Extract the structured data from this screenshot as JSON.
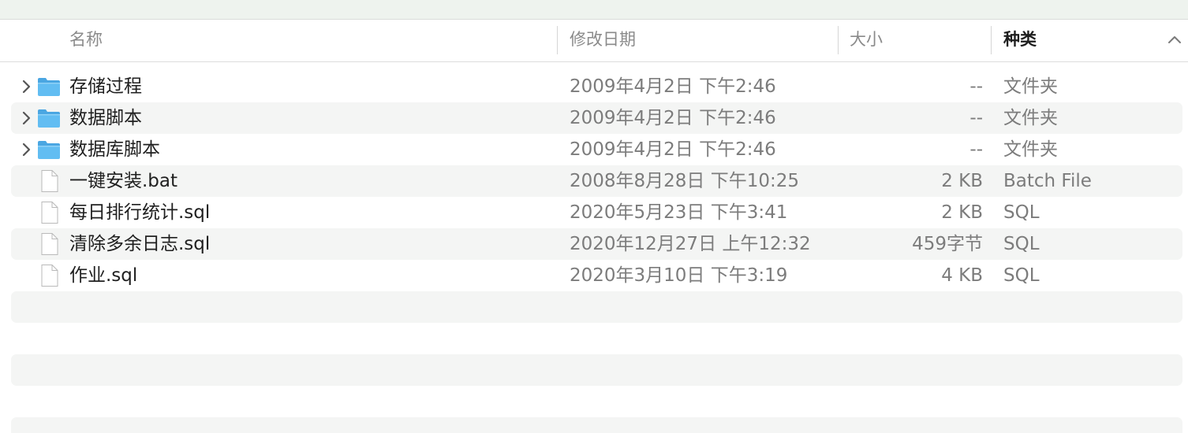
{
  "columns": {
    "name": "名称",
    "date": "修改日期",
    "size": "大小",
    "kind": "种类"
  },
  "rows": [
    {
      "name": "存储过程",
      "date": "2009年4月2日 下午2:46",
      "size": "--",
      "kind": "文件夹",
      "type": "folder"
    },
    {
      "name": "数据脚本",
      "date": "2009年4月2日 下午2:46",
      "size": "--",
      "kind": "文件夹",
      "type": "folder"
    },
    {
      "name": "数据库脚本",
      "date": "2009年4月2日 下午2:46",
      "size": "--",
      "kind": "文件夹",
      "type": "folder"
    },
    {
      "name": "一键安装.bat",
      "date": "2008年8月28日 下午10:25",
      "size": "2 KB",
      "kind": "Batch File",
      "type": "file"
    },
    {
      "name": "每日排行统计.sql",
      "date": "2020年5月23日 下午3:41",
      "size": "2 KB",
      "kind": "SQL",
      "type": "file"
    },
    {
      "name": "清除多余日志.sql",
      "date": "2020年12月27日 上午12:32",
      "size": "459字节",
      "kind": "SQL",
      "type": "file"
    },
    {
      "name": "作业.sql",
      "date": "2020年3月10日 下午3:19",
      "size": "4 KB",
      "kind": "SQL",
      "type": "file"
    }
  ],
  "icons": {
    "folder": "folder-icon",
    "file": "document-icon",
    "disclosure": "chevron-right-icon",
    "sort": "chevron-up-icon"
  },
  "colors": {
    "folder": "#5ab4ea",
    "stripe": "#f4f5f4"
  }
}
